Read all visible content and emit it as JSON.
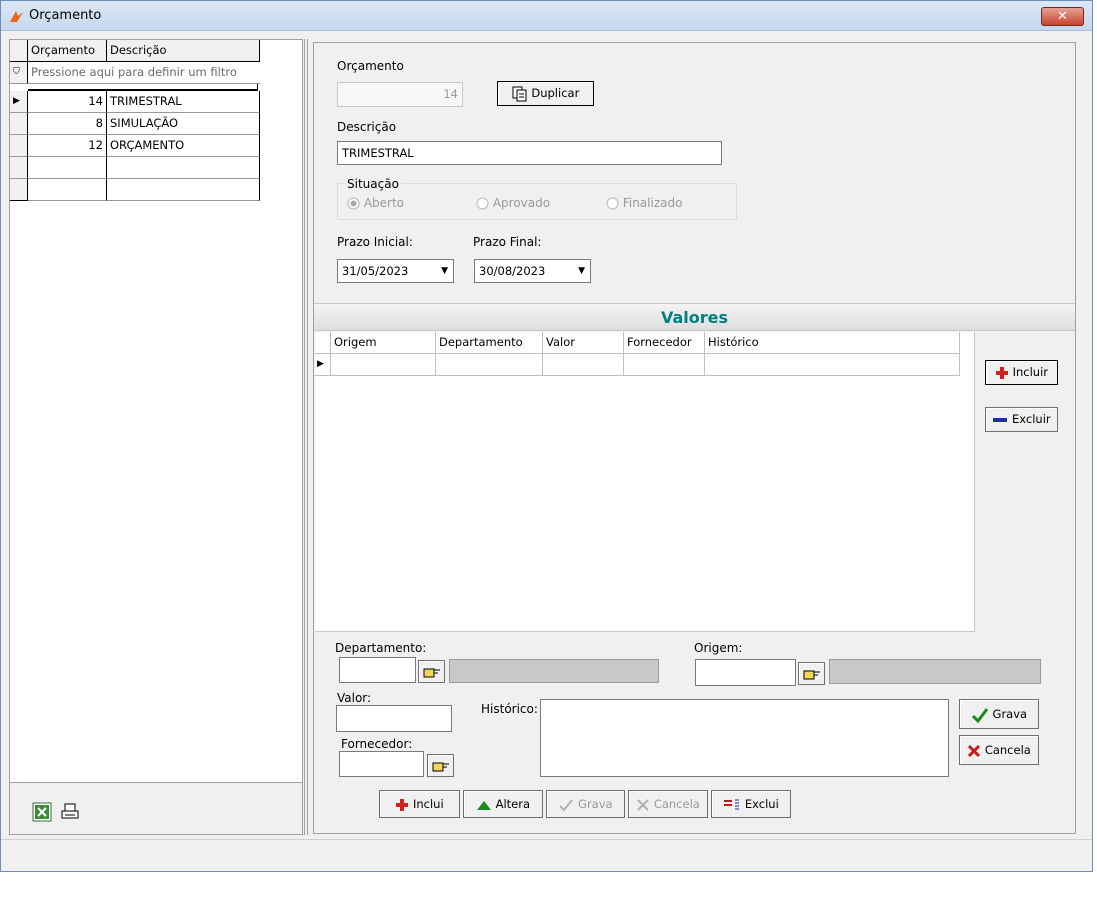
{
  "window": {
    "title": "Orçamento",
    "close_glyph": "✕"
  },
  "list": {
    "columns": [
      "Orçamento",
      "Descrição"
    ],
    "filter_text": "Pressione aqui para definir um filtro",
    "rows": [
      {
        "id": "14",
        "desc": "TRIMESTRAL"
      },
      {
        "id": "8",
        "desc": "SIMULAÇÃO"
      },
      {
        "id": "12",
        "desc": "ORÇAMENTO"
      }
    ]
  },
  "form": {
    "orcamento_label": "Orçamento",
    "orcamento_value": "14",
    "duplicar_label": "Duplicar",
    "descricao_label": "Descrição",
    "descricao_value": "TRIMESTRAL",
    "situacao_label": "Situação",
    "situacao_options": [
      "Aberto",
      "Aprovado",
      "Finalizado"
    ],
    "prazo_inicial_label": "Prazo Inicial:",
    "prazo_inicial_value": "31/05/2023",
    "prazo_final_label": "Prazo Final:",
    "prazo_final_value": "30/08/2023"
  },
  "valores": {
    "header": "Valores",
    "columns": [
      "Origem",
      "Departamento",
      "Valor",
      "Fornecedor",
      "Histórico"
    ],
    "incluir_label": "Incluir",
    "excluir_label": "Excluir"
  },
  "edit": {
    "departamento_label": "Departamento:",
    "origem_label": "Origem:",
    "valor_label": "Valor:",
    "historico_label": "Histórico:",
    "fornecedor_label": "Fornecedor:",
    "grava_label": "Grava",
    "cancela_label": "Cancela"
  },
  "toolbar": {
    "inclui": "Inclui",
    "altera": "Altera",
    "grava": "Grava",
    "cancela": "Cancela",
    "exclui": "Exclui"
  },
  "colors": {
    "valores_header": "#008080",
    "accent_red": "#d0211c",
    "accent_green": "#1a8a1a",
    "accent_blue": "#1c2f9a"
  }
}
